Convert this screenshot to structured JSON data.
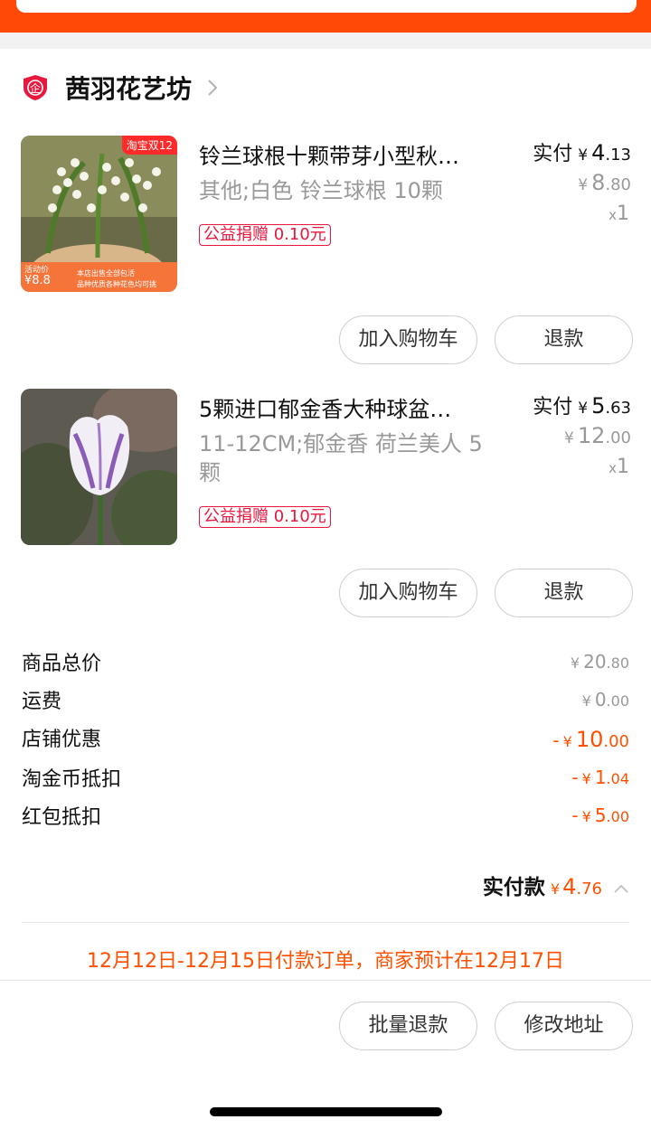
{
  "shop": {
    "name": "茜羽花艺坊"
  },
  "items": [
    {
      "title": "铃兰球根十颗带芽小型秋…",
      "spec": "其他;白色 铃兰球根 10颗",
      "charity": "公益捐赠 0.10元",
      "paid_label": "实付",
      "paid_int": "4",
      "paid_dec": ".13",
      "orig_int": "8",
      "orig_dec": ".80",
      "qty": "1",
      "badge": "淘宝双12",
      "promo_tag": "活动价",
      "promo_price": "8.8",
      "promo_line1": "本店出售全部包活",
      "promo_line2": "品种优质各种花色均可挑",
      "btn_cart": "加入购物车",
      "btn_refund": "退款"
    },
    {
      "title": "5颗进口郁金香大种球盆…",
      "spec": "11-12CM;郁金香 荷兰美人 5 颗",
      "charity": "公益捐赠 0.10元",
      "paid_label": "实付",
      "paid_int": "5",
      "paid_dec": ".63",
      "orig_int": "12",
      "orig_dec": ".00",
      "qty": "1",
      "btn_cart": "加入购物车",
      "btn_refund": "退款"
    }
  ],
  "summary": [
    {
      "label": "商品总价",
      "prefix": "",
      "int": "20",
      "dec": ".80",
      "highlight": false
    },
    {
      "label": "运费",
      "prefix": "",
      "int": "0",
      "dec": ".00",
      "highlight": false
    },
    {
      "label": "店铺优惠",
      "prefix": "-",
      "int": "10",
      "dec": ".00",
      "highlight": true
    },
    {
      "label": "淘金币抵扣",
      "prefix": "-",
      "int": "1",
      "dec": ".04",
      "highlight": true
    },
    {
      "label": "红包抵扣",
      "prefix": "-",
      "int": "5",
      "dec": ".00",
      "highlight": true
    }
  ],
  "total": {
    "label": "实付款",
    "int": "4",
    "dec": ".76"
  },
  "currency": "¥",
  "qty_prefix": "x",
  "notice": "12月12日-12月15日付款订单，商家预计在12月17日",
  "bottom": {
    "batch_refund": "批量退款",
    "change_address": "修改地址"
  },
  "colors": {
    "accent": "#ff5000",
    "topbar": "#ff4a07",
    "charity": "#e8173e"
  }
}
